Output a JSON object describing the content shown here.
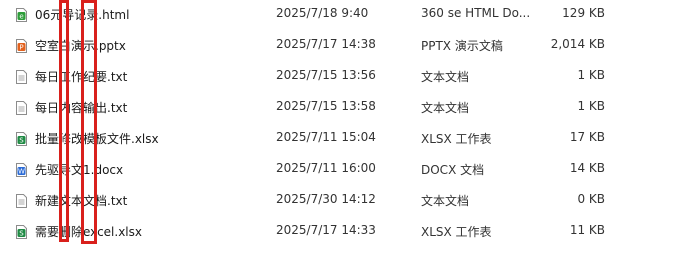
{
  "files": [
    {
      "name": "06元导记录.html",
      "date": "2025/7/18 9:40",
      "type": "360 se HTML Do...",
      "size": "129 KB",
      "icon": "html-icon"
    },
    {
      "name": "空室白演示.pptx",
      "date": "2025/7/17 14:38",
      "type": "PPTX 演示文稿",
      "size": "2,014 KB",
      "icon": "pptx-icon"
    },
    {
      "name": "每日工作纪要.txt",
      "date": "2025/7/15 13:56",
      "type": "文本文档",
      "size": "1 KB",
      "icon": "txt-icon"
    },
    {
      "name": "每日内容输出.txt",
      "date": "2025/7/15 13:58",
      "type": "文本文档",
      "size": "1 KB",
      "icon": "txt-icon"
    },
    {
      "name": "批量修改模板文件.xlsx",
      "date": "2025/7/11 15:04",
      "type": "XLSX 工作表",
      "size": "17 KB",
      "icon": "xlsx-icon"
    },
    {
      "name": "先驱导文1.docx",
      "date": "2025/7/11 16:00",
      "type": "DOCX 文档",
      "size": "14 KB",
      "icon": "docx-icon"
    },
    {
      "name": "新建文本文档.txt",
      "date": "2025/7/30 14:12",
      "type": "文本文档",
      "size": "0 KB",
      "icon": "txt-icon"
    },
    {
      "name": "需要删除excel.xlsx",
      "date": "2025/7/17 14:33",
      "type": "XLSX 工作表",
      "size": "11 KB",
      "icon": "xlsx-icon"
    }
  ],
  "highlight_color": "#d9201c"
}
